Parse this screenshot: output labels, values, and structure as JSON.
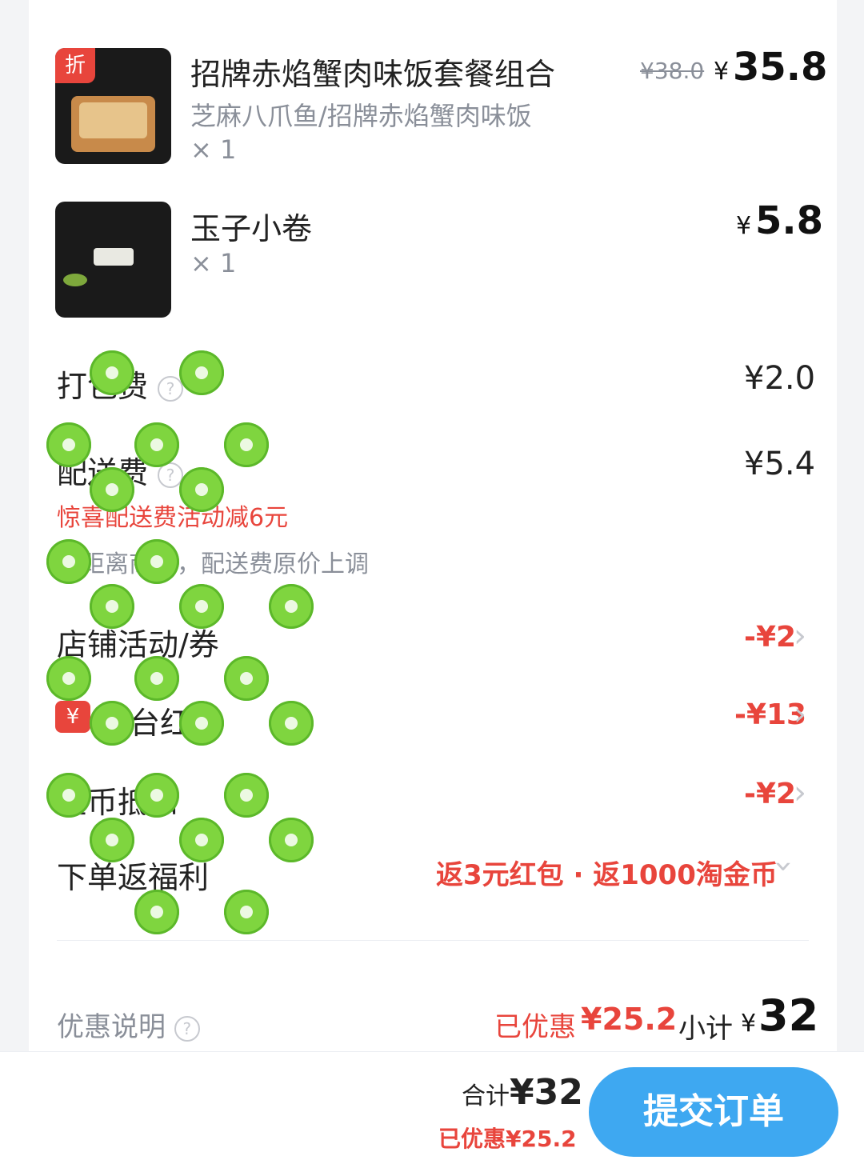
{
  "items": [
    {
      "tag": "折",
      "title": "招牌赤焰蟹肉味饭套餐组合",
      "spec": "芝麻八爪鱼/招牌赤焰蟹肉味饭",
      "qty": "× 1",
      "original_price": "¥38.0",
      "yen": "¥",
      "price": "35.8"
    },
    {
      "title": "玉子小卷",
      "qty": "× 1",
      "yen": "¥",
      "price": "5.8"
    }
  ],
  "fees": {
    "packing_label": "打包费",
    "packing_value": "¥2.0",
    "delivery_label": "配送费",
    "delivery_value": "¥5.4",
    "delivery_promo": "惊喜配送费活动减6元",
    "delivery_note": "因距离商家，配送费原价上调"
  },
  "discounts": {
    "store_label": "店铺活动/券",
    "store_value": "-¥2",
    "platform_badge": "¥",
    "platform_label": "平台红包",
    "platform_value": "-¥13",
    "coin_label": "金币抵扣",
    "coin_value": "-¥2",
    "benefit_label": "下单返福利",
    "benefit_value": "返3元红包 · 返1000淘金币"
  },
  "summary": {
    "explain_label": "优惠说明",
    "saved_label": "已优惠",
    "saved_value": "¥25.2",
    "subtotal_label": "小计",
    "subtotal_yen": "¥",
    "subtotal_value": "32"
  },
  "footer": {
    "total_label": "合计",
    "total_value": "¥32",
    "saved_text": "已优惠¥25.2",
    "submit_label": "提交订单"
  },
  "colors": {
    "accent_blue": "#3ea8f1",
    "discount_red": "#e8453c",
    "kiwi_green": "#7fd53f"
  }
}
